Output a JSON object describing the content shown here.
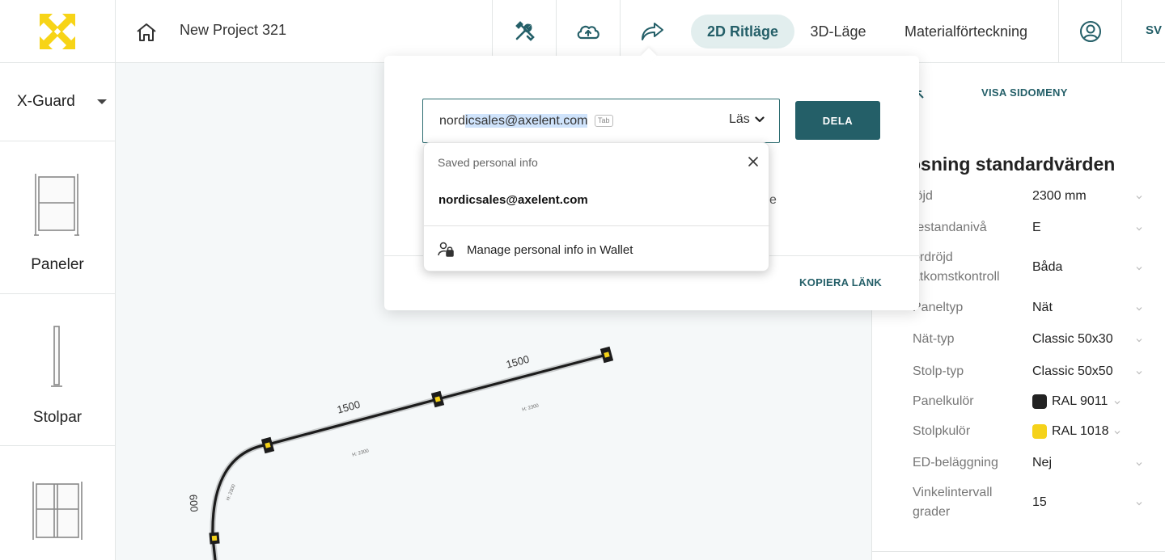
{
  "header": {
    "project_name": "New Project 321",
    "modes": [
      {
        "label": "2D Ritläge",
        "active": true
      },
      {
        "label": "3D-Läge",
        "active": false
      },
      {
        "label": "Materialförteckning",
        "active": false
      }
    ],
    "language": "SV",
    "icons": {
      "logo": "xguard-logo-icon",
      "home": "home-icon",
      "tools": "tools-icon",
      "cloud": "cloud-upload-icon",
      "share": "share-icon",
      "user": "user-icon"
    }
  },
  "sidebar": {
    "product": "X-Guard",
    "categories": [
      {
        "label": "Paneler",
        "icon": "panel-icon"
      },
      {
        "label": "Stolpar",
        "icon": "post-icon"
      },
      {
        "label": "",
        "icon": "door-panel-icon"
      }
    ]
  },
  "canvas": {
    "dimensions": [
      {
        "value": "1500"
      },
      {
        "value": "1500"
      },
      {
        "value": "600"
      }
    ],
    "height_labels": [
      "H: 2300",
      "H: 2300",
      "H: 2300"
    ]
  },
  "right_panel": {
    "toggle_label": "VISA SIDOMENY",
    "title": "ösning standardvärden",
    "properties": [
      {
        "label": "löjd",
        "value": "2300 mm"
      },
      {
        "label": "restandanivå",
        "value": "E"
      },
      {
        "label": "ördröjd\nåtkomstkontroll",
        "value": "Båda"
      },
      {
        "label": "Paneltyp",
        "value": "Nät"
      },
      {
        "label": "Nät-typ",
        "value": "Classic 50x30"
      },
      {
        "label": "Stolp-typ",
        "value": "Classic 50x50"
      },
      {
        "label": "Panelkulör",
        "value": "RAL 9011",
        "swatch": "#222222"
      },
      {
        "label": "Stolpkulör",
        "value": "RAL 1018",
        "swatch": "#f5d21a"
      },
      {
        "label": "ED-beläggning",
        "value": "Nej"
      },
      {
        "label": "Vinkelintervall\ngrader",
        "value": "15"
      }
    ]
  },
  "share_dialog": {
    "email_prefix": "nord",
    "email_selected": "icsales@axelent.com",
    "tab_hint": "Tab",
    "permission": "Läs",
    "share_button": "DELA",
    "partial_text": "e",
    "copy_link": "KOPIERA LÄNK"
  },
  "autofill": {
    "heading": "Saved personal info",
    "suggestion": "nordicsales@axelent.com",
    "manage_label": "Manage personal info in Wallet"
  },
  "colors": {
    "accent": "#245f68",
    "accent_light": "#e2eeee",
    "logo_yellow": "#f7d417",
    "canvas_bg": "#f5f8f9"
  }
}
